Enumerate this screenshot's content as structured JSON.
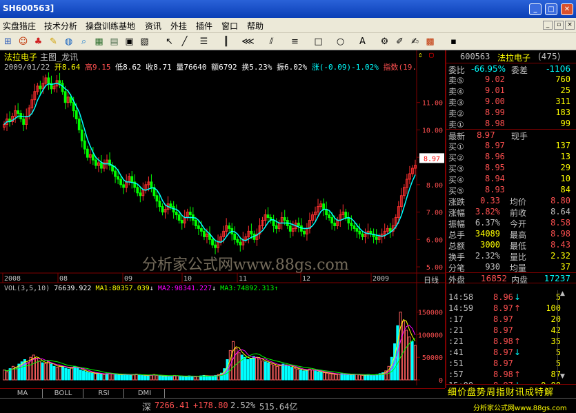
{
  "window": {
    "title": "SH600563]"
  },
  "menu": [
    "实盘猎庄",
    "技术分析",
    "操盘训练基地",
    "资讯",
    "外挂",
    "插件",
    "窗口",
    "帮助"
  ],
  "chart_header": {
    "name": "法拉电子",
    "view": "主图_龙讯",
    "date": "2009/01/22",
    "open": "开8.64",
    "high": "高9.15",
    "low": "低8.62",
    "close": "收8.71",
    "volume": "量76640",
    "amount": "额6792",
    "turnover": "换5.23%",
    "amplitude": "振6.02%",
    "change": "涨(-0.09)-1.02%",
    "index": "指数(19."
  },
  "chart_data": [
    {
      "type": "candlestick",
      "title": "",
      "x_labels": [
        "2008",
        "08",
        "09",
        "10",
        "11",
        "12",
        "2009"
      ],
      "y_ticks": [
        5.0,
        6.0,
        7.0,
        8.0,
        9.0,
        10.0,
        11.0
      ],
      "ylim": [
        4.8,
        12.2
      ],
      "price_marker": "8.97",
      "close": [
        10.2,
        10.4,
        10.3,
        10.5,
        10.7,
        10.6,
        10.4,
        10.2,
        10.5,
        10.8,
        11.1,
        11.4,
        11.6,
        11.5,
        11.7,
        11.9,
        11.7,
        11.5,
        11.6,
        11.8,
        11.7,
        11.4,
        11.0,
        11.2,
        11.0,
        10.7,
        10.4,
        10.0,
        9.6,
        9.3,
        9.0,
        9.1,
        8.9,
        8.7,
        8.8,
        8.6,
        8.8,
        8.9,
        8.7,
        8.5,
        8.3,
        8.2,
        8.0,
        7.9,
        8.1,
        8.3,
        8.1,
        7.9,
        7.7,
        7.6,
        7.8,
        8.0,
        8.1,
        7.9,
        7.6,
        7.4,
        7.2,
        7.0,
        7.1,
        7.3,
        7.2,
        7.0,
        6.9,
        6.7,
        6.6,
        6.8,
        7.0,
        6.9,
        6.7,
        6.5,
        6.4,
        6.3,
        6.1,
        6.2,
        6.0,
        5.8,
        5.7,
        5.9,
        6.1,
        6.3,
        6.5,
        6.4,
        6.2,
        6.0,
        5.9,
        5.8,
        6.0,
        6.1,
        6.3,
        6.2,
        6.0,
        6.2,
        6.5,
        6.7,
        6.9,
        6.8,
        6.7,
        6.5,
        6.4,
        6.6,
        6.8,
        6.7,
        6.5,
        6.3,
        6.4,
        6.6,
        6.5,
        6.3,
        6.2,
        6.4,
        6.7,
        6.9,
        7.0,
        7.2,
        7.3,
        7.1,
        6.9,
        6.8,
        6.6,
        6.5,
        6.7,
        6.9,
        7.0,
        6.8,
        6.6,
        6.5,
        6.4,
        6.3,
        6.2,
        6.1,
        6.2,
        6.3,
        6.2,
        6.1,
        6.0,
        6.1,
        6.2,
        6.3,
        6.4,
        6.3,
        6.5,
        6.8,
        7.2,
        7.6,
        7.9,
        8.2,
        8.4,
        8.6,
        8.71
      ]
    },
    {
      "type": "bar",
      "title": "",
      "series_name": "VOL",
      "y_ticks": [
        0,
        50000,
        100000,
        150000
      ],
      "ylim": [
        0,
        180000
      ],
      "values": [
        22000,
        18000,
        25000,
        30000,
        28000,
        35000,
        40000,
        45000,
        38000,
        50000,
        55000,
        48000,
        42000,
        38000,
        36000,
        40000,
        35000,
        30000,
        28000,
        32000,
        30000,
        26000,
        24000,
        28000,
        30000,
        26000,
        22000,
        20000,
        18000,
        16000,
        15000,
        14000,
        15000,
        13000,
        12000,
        14000,
        15000,
        13000,
        12000,
        11000,
        12000,
        13000,
        11000,
        10000,
        12000,
        13000,
        11000,
        10000,
        9000,
        10000,
        11000,
        12000,
        10000,
        9000,
        8000,
        9000,
        8000,
        9000,
        10000,
        9000,
        8000,
        7000,
        8000,
        9000,
        8000,
        7000,
        8000,
        9000,
        10000,
        9000,
        8000,
        9000,
        10000,
        12000,
        15000,
        25000,
        45000,
        65000,
        85000,
        70000,
        60000,
        55000,
        50000,
        45000,
        48000,
        52000,
        50000,
        46000,
        42000,
        40000,
        38000,
        35000,
        33000,
        30000,
        32000,
        35000,
        33000,
        30000,
        28000,
        26000,
        24000,
        22000,
        20000,
        22000,
        24000,
        22000,
        20000,
        18000,
        17000,
        16000,
        15000,
        14000,
        13000,
        12000,
        13000,
        14000,
        12000,
        11000,
        12000,
        13000,
        12000,
        11000,
        10000,
        11000,
        12000,
        11000,
        10000,
        12000,
        14000,
        16000,
        20000,
        30000,
        50000,
        80000,
        120000,
        150000,
        130000,
        110000,
        95000,
        85000,
        76640
      ]
    }
  ],
  "indicator_header": {
    "label": "VOL(3,5,10)",
    "value": "76639.922",
    "ma1": "MA1:80357.039",
    "ma2": "MA2:98341.227",
    "ma3": "MA3:74892.313"
  },
  "watermark": "分析家公式网www.88gs.com",
  "ri_label": "日线",
  "quote": {
    "code": "600563",
    "name": "法拉电子",
    "num": "(475)",
    "weibi_label": "委比",
    "weibi": "-66.95%",
    "weicha_label": "委差",
    "weicha": "-1106",
    "sell": [
      {
        "l": "卖⑤",
        "p": "9.02",
        "v": "760"
      },
      {
        "l": "卖④",
        "p": "9.01",
        "v": "25"
      },
      {
        "l": "卖③",
        "p": "9.00",
        "v": "311"
      },
      {
        "l": "卖②",
        "p": "8.99",
        "v": "183"
      },
      {
        "l": "卖①",
        "p": "8.98",
        "v": "99"
      }
    ],
    "latest_label": "最新",
    "latest": "8.97",
    "xianshou": "现手",
    "buy": [
      {
        "l": "买①",
        "p": "8.97",
        "v": "137"
      },
      {
        "l": "买②",
        "p": "8.96",
        "v": "13"
      },
      {
        "l": "买③",
        "p": "8.95",
        "v": "29"
      },
      {
        "l": "买④",
        "p": "8.94",
        "v": "10"
      },
      {
        "l": "买⑤",
        "p": "8.93",
        "v": "84"
      }
    ],
    "stats": [
      {
        "a": "涨跌",
        "b": "0.33",
        "c": "均价",
        "d": "8.80"
      },
      {
        "a": "涨幅",
        "b": "3.82%",
        "c": "前收",
        "d": "8.64"
      },
      {
        "a": "振幅",
        "b": "6.37%",
        "c": "今开",
        "d": "8.58"
      },
      {
        "a": "总手",
        "b": "34089",
        "c": "最高",
        "d": "8.98"
      },
      {
        "a": "总额",
        "b": "3000",
        "c": "最低",
        "d": "8.43"
      },
      {
        "a": "换手",
        "b": "2.32%",
        "c": "量比",
        "d": "2.32"
      },
      {
        "a": "分笔",
        "b": "930",
        "c": "均量",
        "d": "37"
      }
    ],
    "outer_label": "外盘",
    "outer": "16852",
    "inner_label": "内盘",
    "inner": "17237",
    "ticks": [
      {
        "t": "14:58",
        "p": "8.96",
        "a": "↓",
        "v": "5"
      },
      {
        "t": "14:59",
        "p": "8.97",
        "a": "↑",
        "v": "100"
      },
      {
        "t": ":17",
        "p": "8.97",
        "a": "",
        "v": "20"
      },
      {
        "t": ":21",
        "p": "8.97",
        "a": "",
        "v": "42"
      },
      {
        "t": ":21",
        "p": "8.98",
        "a": "↑",
        "v": "35"
      },
      {
        "t": ":41",
        "p": "8.97",
        "a": "↓",
        "v": "5"
      },
      {
        "t": ":51",
        "p": "8.97",
        "a": "",
        "v": "5"
      },
      {
        "t": ":57",
        "p": "8.98",
        "a": "↑",
        "v": "87"
      },
      {
        "t": "15:00",
        "p": "8.97",
        "a": "↓",
        "v": "0.00"
      }
    ]
  },
  "bottom_tabs": [
    "MA",
    "BOLL",
    "RSI",
    "DMI"
  ],
  "right_tabs": "细价盘势周指财讯成特解",
  "status": {
    "market": "深",
    "index": "7266.41",
    "change": "+178.80",
    "pct": "2.52%",
    "amount": "515.64亿",
    "site": "分析家公式网www.88gs.com"
  }
}
